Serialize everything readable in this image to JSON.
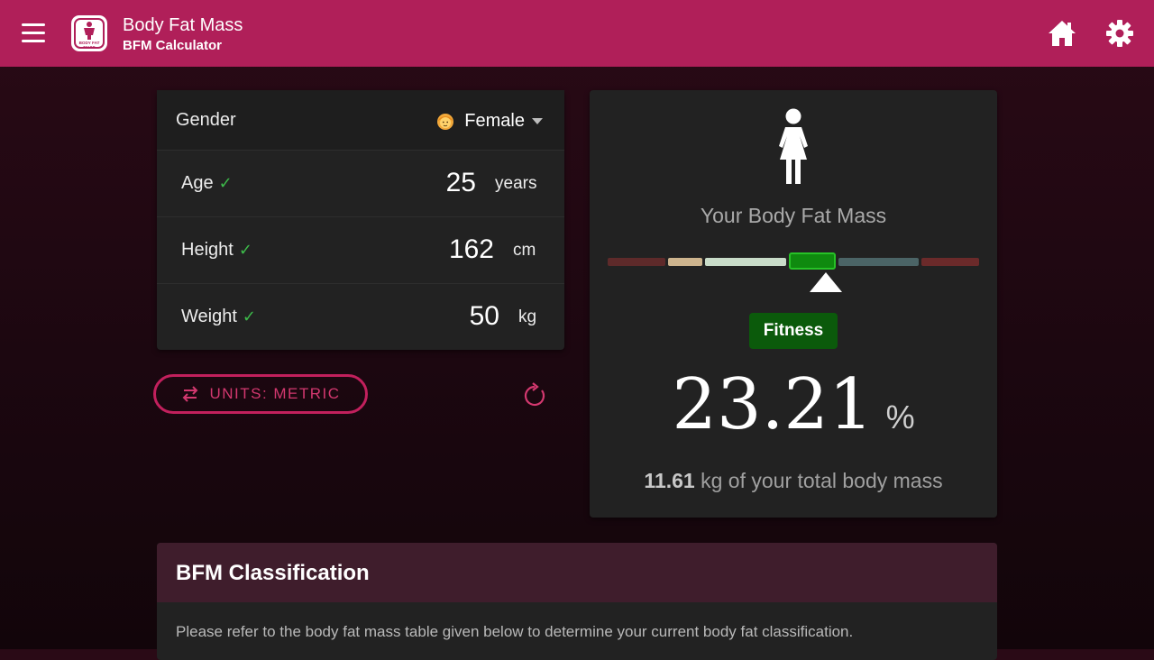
{
  "app": {
    "title": "Body Fat Mass",
    "subtitle": "BFM Calculator",
    "logo_text": "BODY FAT MASS"
  },
  "form": {
    "gender": {
      "label": "Gender",
      "value": "Female"
    },
    "age": {
      "label": "Age",
      "check": "✓",
      "value": "25",
      "unit": "years"
    },
    "height": {
      "label": "Height",
      "check": "✓",
      "value": "162",
      "unit": "cm"
    },
    "weight": {
      "label": "Weight",
      "check": "✓",
      "value": "50",
      "unit": "kg"
    }
  },
  "units_button": {
    "label": "UNITS: METRIC"
  },
  "result": {
    "title": "Your Body Fat Mass",
    "category": "Fitness",
    "value": "23.21",
    "unit": "%",
    "mass_value": "11.61",
    "mass_text": "kg of your total body mass",
    "scale_colors": [
      "#5e2a2a",
      "#cdb48e",
      "#c9dcc9",
      "#0f8a0f",
      "#4b6466",
      "#6b2a2a"
    ],
    "active_segment": "Fitness"
  },
  "classification": {
    "title": "BFM Classification",
    "description": "Please refer to the body fat mass table given below to determine your current body fat classification."
  },
  "colors": {
    "appbar": "#b01f59",
    "accent": "#c2205d",
    "card": "#222222",
    "badge": "#0b5a0b"
  }
}
